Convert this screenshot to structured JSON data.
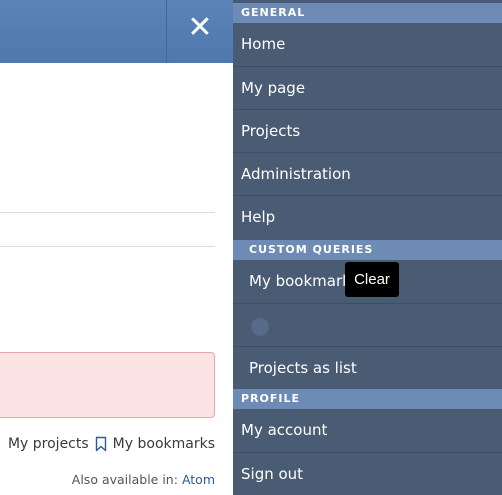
{
  "header": {
    "close_icon": "close-icon"
  },
  "main": {
    "links": {
      "my_projects": "My projects",
      "my_bookmarks": "My bookmarks"
    },
    "also_available": {
      "prefix": "Also available in:",
      "atom": "Atom"
    }
  },
  "menu": {
    "general": {
      "title": "GENERAL",
      "items": [
        {
          "label": "Home"
        },
        {
          "label": "My page"
        },
        {
          "label": "Projects"
        },
        {
          "label": "Administration"
        },
        {
          "label": "Help"
        }
      ]
    },
    "custom_queries": {
      "title": "CUSTOM QUERIES",
      "items": [
        {
          "label": "My bookmark"
        },
        {
          "label": ""
        },
        {
          "label": "Projects as list"
        }
      ]
    },
    "profile": {
      "title": "PROFILE",
      "items": [
        {
          "label": "My account"
        },
        {
          "label": "Sign out"
        }
      ]
    }
  },
  "tooltip": {
    "text": "Clear"
  },
  "colors": {
    "topbar": "#5a84b8",
    "menu_bg": "#4a5b74",
    "section_header": "#6d8bb5",
    "error_bg": "#fbe3e4"
  }
}
